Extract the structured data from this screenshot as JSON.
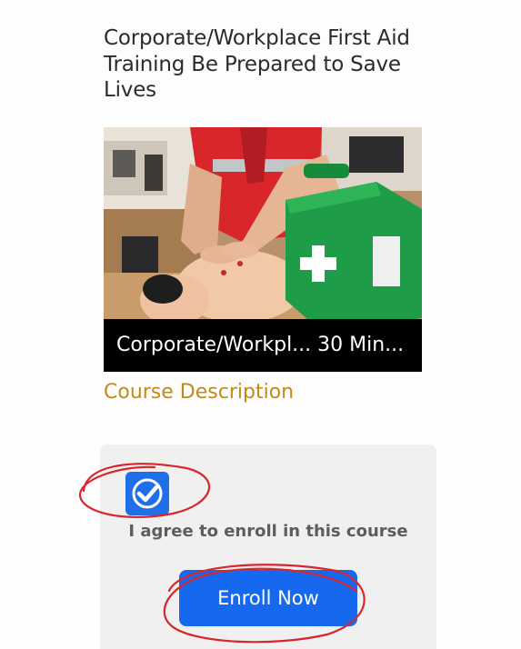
{
  "course": {
    "title": "Corporate/Workplace First Aid Training Be Prepared to Save Lives",
    "caption": "Corporate/Workpl... 30 Min...",
    "section_heading": "Course Description"
  },
  "enroll": {
    "agree_checked": true,
    "agree_label": "I agree to enroll in this course",
    "button_label": "Enroll Now"
  },
  "colors": {
    "accent_blue": "#1669ef",
    "heading_gold": "#c58a16",
    "annotation_red": "#d9252c"
  },
  "icons": {
    "checkbox": "checkmark-icon",
    "first_aid_kit": "first-aid-cross-icon"
  }
}
